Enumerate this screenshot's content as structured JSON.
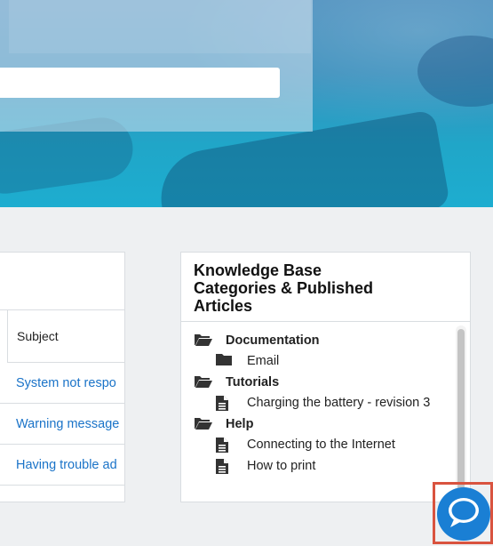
{
  "search": {
    "placeholder": "",
    "value": ""
  },
  "tickets": {
    "subject_header": "Subject",
    "rows": [
      {
        "subject": "System not respo"
      },
      {
        "subject": "Warning message"
      },
      {
        "subject": "Having trouble ad"
      }
    ]
  },
  "knowledge_base": {
    "title_line1": "Knowledge Base",
    "title_line2": "Categories & Published",
    "title_line3": "Articles",
    "items": [
      {
        "label": "Documentation",
        "kind": "category",
        "icon": "folder-open-icon"
      },
      {
        "label": "Email",
        "kind": "subcategory",
        "icon": "folder-icon"
      },
      {
        "label": "Tutorials",
        "kind": "category",
        "icon": "folder-open-icon"
      },
      {
        "label": "Charging the battery - revision 3",
        "kind": "article",
        "icon": "document-icon"
      },
      {
        "label": "Help",
        "kind": "category",
        "icon": "folder-open-icon"
      },
      {
        "label": "Connecting to the Internet",
        "kind": "article",
        "icon": "document-icon"
      },
      {
        "label": "How to print",
        "kind": "article",
        "icon": "document-icon"
      }
    ]
  },
  "chat": {
    "icon": "chat-bubble-icon",
    "highlight_color": "#d9533f",
    "button_color": "#1a7fd4"
  },
  "colors": {
    "link": "#1a73c8",
    "hero_top": "#4b8fbe",
    "hero_bottom": "#1dadd0"
  }
}
